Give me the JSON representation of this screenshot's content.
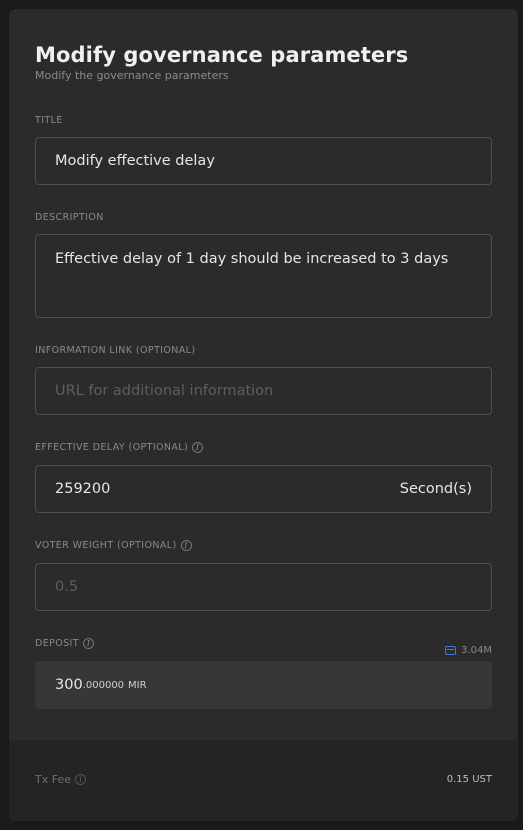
{
  "header": {
    "title": "Modify governance parameters",
    "subtitle": "Modify the governance parameters"
  },
  "form": {
    "title": {
      "label": "TITLE",
      "value": "Modify effective delay"
    },
    "description": {
      "label": "DESCRIPTION",
      "value": "Effective delay of 1 day should be increased to 3 days"
    },
    "info_link": {
      "label": "INFORMATION LINK (OPTIONAL)",
      "value": "",
      "placeholder": "URL for additional information"
    },
    "effective_delay": {
      "label": "EFFECTIVE DELAY (OPTIONAL)",
      "value": "259200",
      "unit": "Second(s)"
    },
    "voter_weight": {
      "label": "VOTER WEIGHT (OPTIONAL)",
      "value": "",
      "placeholder": "0.5"
    },
    "deposit": {
      "label": "DEPOSIT",
      "balance": "3.04M",
      "value_int": "300",
      "value_dec": ".000000",
      "denom": "MIR"
    }
  },
  "footer": {
    "fee_label": "Tx Fee",
    "fee_value": "0.15 UST"
  },
  "icons": {
    "info": "info-icon",
    "wallet": "wallet-icon"
  },
  "colors": {
    "accent": "#3f7bd8",
    "panel": "#2b2b2b",
    "background": "#1a1a1a"
  }
}
